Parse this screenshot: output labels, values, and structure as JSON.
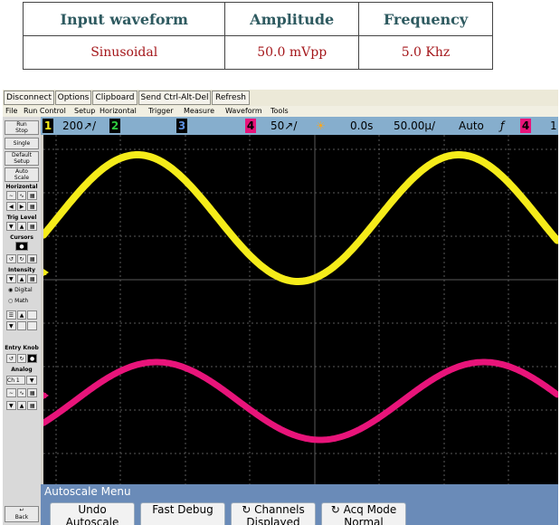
{
  "spec_table": {
    "headers": [
      "Input waveform",
      "Amplitude",
      "Frequency"
    ],
    "values": [
      "Sinusoidal",
      "50.0 mVpp",
      "5.0 Khz"
    ]
  },
  "vnc_toolbar": [
    "Disconnect",
    "Options",
    "Clipboard",
    "Send Ctrl-Alt-Del",
    "Refresh"
  ],
  "menu": [
    "File",
    "Run Control",
    "Setup",
    "Horizontal",
    "Trigger",
    "Measure",
    "Waveform",
    "Tools"
  ],
  "status": {
    "ch1": "1",
    "ch1_scale": "200↗/",
    "ch2": "2",
    "ch3": "3",
    "ch4": "4",
    "ch4_scale": "50↗/",
    "delay": "0.0s",
    "timebase": "50.00µ/",
    "mode": "Auto",
    "slope": "ƒ",
    "trig_ch": "4",
    "trig_more": "1"
  },
  "left_panel": {
    "run_stop": "Run\nStop",
    "single": "Single",
    "default_setup": "Default\nSetup",
    "auto_scale": "Auto\nScale",
    "horizontal": "Horizontal",
    "trig_level": "Trig Level",
    "cursors": "Cursors",
    "intensity": "Intensity",
    "digital": "Digital",
    "math": "Math",
    "entry_knob": "Entry Knob",
    "analog": "Analog",
    "analog_ch": "Ch 1",
    "back": "Back"
  },
  "markers": {
    "ch1": "1",
    "ch4": "4"
  },
  "colors": {
    "ch1": "#f5ec1a",
    "ch4": "#e8147a",
    "grid": "#5a5a5a",
    "screen_bg": "#000000",
    "status_bar": "#86aecd",
    "softkey_bar": "#6a8bb8"
  },
  "softkeys": {
    "menu_title": "Autoscale Menu",
    "items": [
      {
        "line1": "Undo",
        "line2": "Autoscale"
      },
      {
        "line1": "Fast Debug",
        "line2": ""
      },
      {
        "line1": "Channels",
        "line2": "Displayed"
      },
      {
        "line1": "Acq Mode",
        "line2": "Normal"
      }
    ]
  }
}
